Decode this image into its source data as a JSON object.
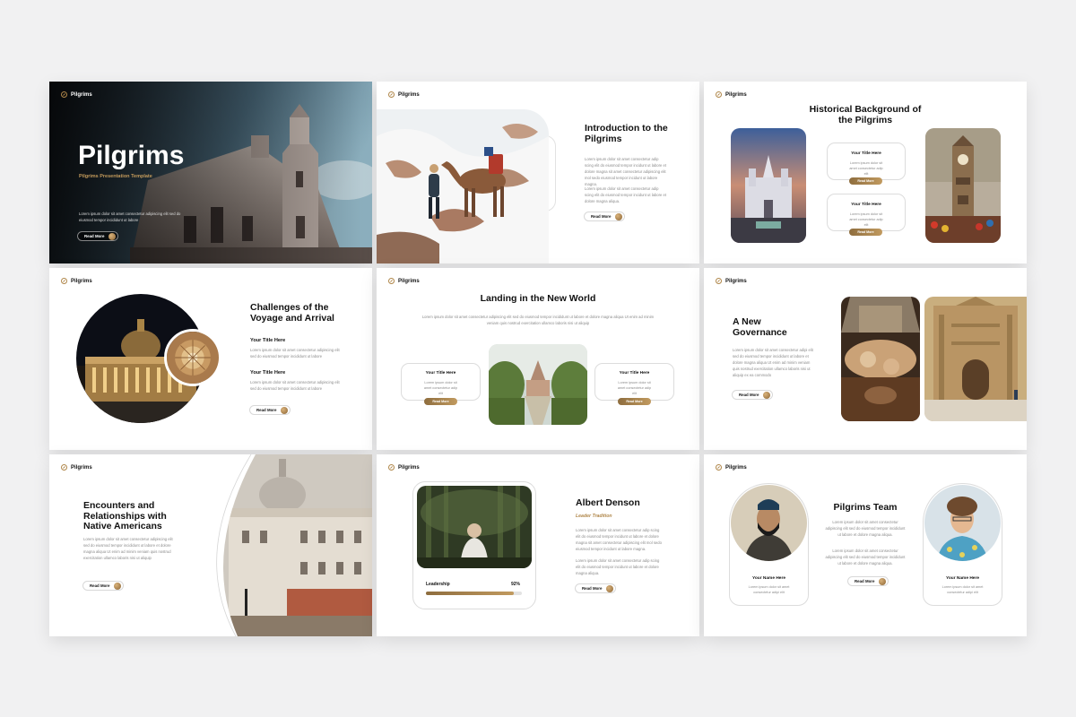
{
  "brand": "Pilgrims",
  "lorem1": "Lorem ipsum dolor sit amet consectetur adipiscing elit sed do eiusmod tempor incididunt ut labore et dolore",
  "lorem_short": "Lorem ipsum dolor sit amet consectetur adipi elit",
  "read_more": "Read More",
  "slide1": {
    "title": "Pilgrims",
    "subtitle": "Pilgrims Presentation Template",
    "text": "Lorem ipsum dolor sit amet consectetur adipiscing elit sed do eiusmod tempor incididunt ut labore"
  },
  "slide2": {
    "title": "Introduction to the Pilgrims",
    "p1": "Lorem ipsum dolor sit amet consectetur adip scing elit do eiusmod tempor incidunt ut labore et dolore magna sit amet consectetur adipiscing elit mol sedo eiusmod tempor incidunt ut labore magna.",
    "p2": "Lorem ipsum dolor sit amet consectetur adip scing elit do eiusmod tempor incidunt ut labore et dolore magna aliqua."
  },
  "slide3": {
    "title": "Historical Background of the Pilgrims",
    "card_title": "Your Title Here",
    "card_text": "Lorem ipsum dolor sit amet consectetur adip elit"
  },
  "slide4": {
    "title": "Challenges of the Voyage and Arrival",
    "sub": "Your Title Here",
    "text": "Lorem ipsum dolor sit amet consectetur adipiscing elit sed do eiusmod tempor incididunt ut labore"
  },
  "slide5": {
    "title": "Landing in the New World",
    "text": "Lorem ipsum dolor sit amet consectetur adipiscing elit sed do eiusmod tempor incididunt ut labore et dolore magna aliqua Ut enim ad minim veniam quis nostrud exercitation ullamco laboris nisi ut aliquip",
    "card_title": "Your Title Here",
    "card_text": "Lorem ipsum dolor sit amet consectetur adip elit"
  },
  "slide6": {
    "title": "A New Governance",
    "text": "Lorem ipsum dolor sit amet consectetur adipi elit sed do eiusmod tempor incididunt ut labore et dolore magna aliqua Ut enim ad minim veniam quis nostrud exercitation ullamco laboris nisi ut aliquip ex ea commodo"
  },
  "slide7": {
    "title": "Encounters and Relationships with Native Americans",
    "text": "Lorem ipsum dolor sit amet consectetur adipiscing elit sed do eiusmod tempor incididunt ut labore et dolore magna aliqua Ut enim ad minim veniam quis nostrud exercitation ullamco laboris nisi ut aliquip"
  },
  "slide8": {
    "name": "Albert Denson",
    "role": "Leader Tradition",
    "p1": "Lorem ipsum dolor sit amet consectetur adip scing elit do eiusmod tempor incidunt ut labore et dolore magna sit amet consectetur adipiscing elit mol sedo eiusmod tempor incidunt ut labore magna.",
    "p2": "Lorem ipsum dolor sit amet consectetur adip scing elit do eiusmod tempor incidunt ut labore et dolore magna aliqua.",
    "skill": "Leadership",
    "percent": "92%",
    "progress": 0.92
  },
  "slide9": {
    "title": "Pilgrims Team",
    "text": "Lorem ipsum dolor sit amet consectetur adipiscing elit sed do eiusmod tempor incididunt ut labore et dolore magna aliqua.",
    "text2": "Lorem ipsum dolor sit amet consectetur adipiscing elit sed do eiusmod tempor incididunt ut labore et dolore magna aliqua.",
    "member_name": "Your Name Here",
    "member_text": "Lorem ipsum dolor sit amet consectetur adipi elit"
  },
  "colors": {
    "accent": "#b0874a",
    "heading": "#111111",
    "body_text": "#8b8b8b"
  },
  "icons": {
    "logo": "compass-logo-icon",
    "read_more_arrow": "gold-dot-icon"
  }
}
